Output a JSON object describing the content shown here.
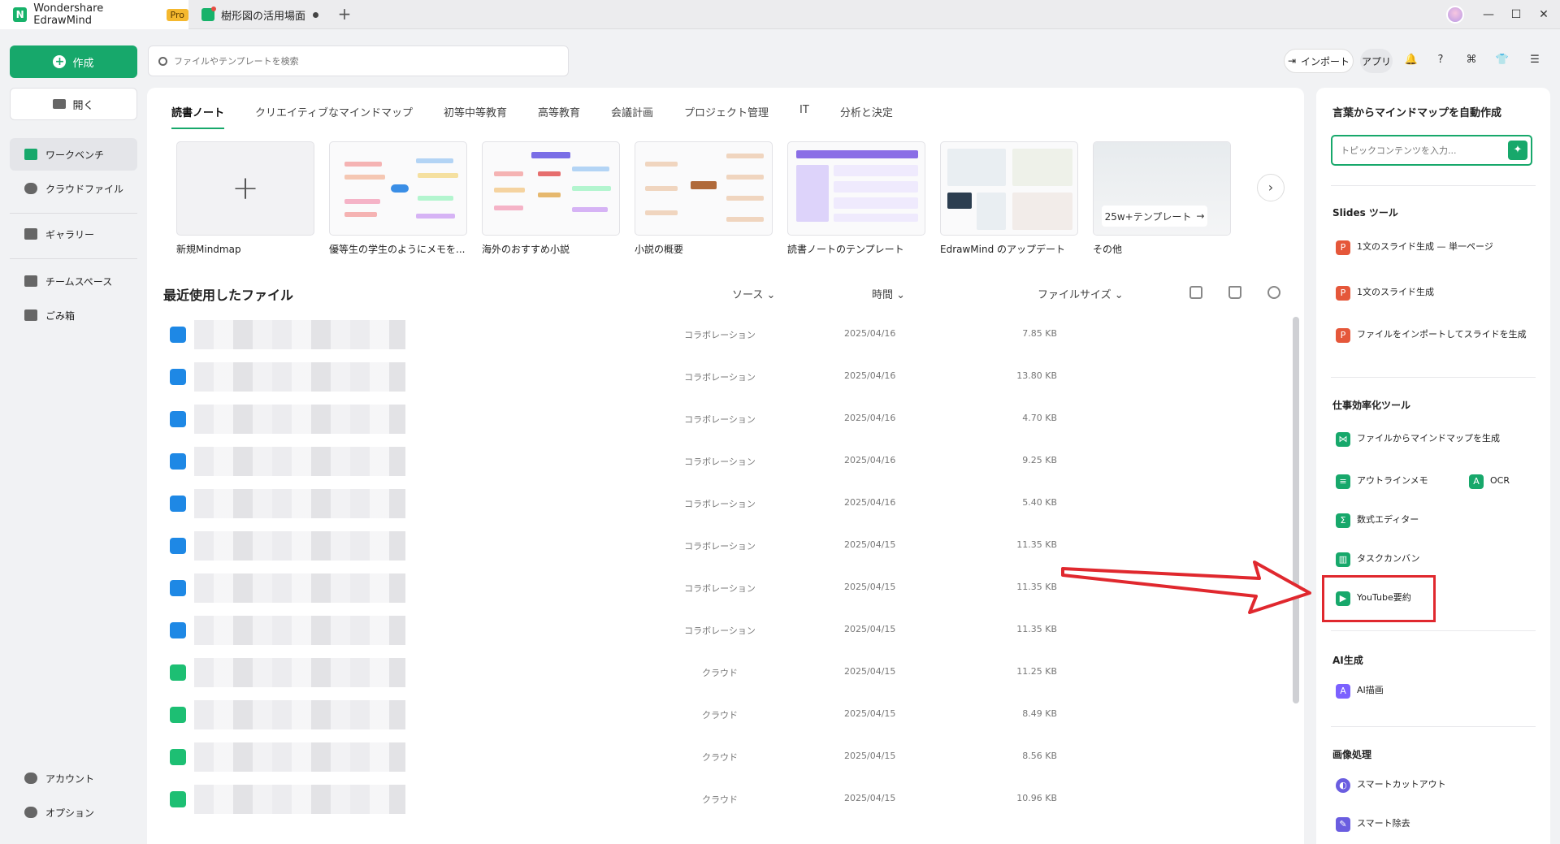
{
  "titlebar": {
    "app_name": "Wondershare EdrawMind",
    "pro_badge": "Pro",
    "doc_tab": "樹形図の活用場面",
    "new_tab": "+",
    "minimize": "—",
    "maximize": "☐",
    "close": "✕"
  },
  "sidebar": {
    "create": "作成",
    "open": "開く",
    "items": [
      {
        "label": "ワークベンチ",
        "icon": "workbench-icon"
      },
      {
        "label": "クラウドファイル",
        "icon": "cloud-icon"
      },
      {
        "label": "ギャラリー",
        "icon": "gallery-icon"
      },
      {
        "label": "チームスペース",
        "icon": "team-icon"
      },
      {
        "label": "ごみ箱",
        "icon": "trash-icon"
      }
    ],
    "account": "アカウント",
    "options": "オプション"
  },
  "search": {
    "placeholder": "ファイルやテンプレートを検索"
  },
  "toolbar": {
    "import": "インポート",
    "apps": "アプリ"
  },
  "categories": [
    "読書ノート",
    "クリエイティブなマインドマップ",
    "初等中等教育",
    "高等教育",
    "会議計画",
    "プロジェクト管理",
    "IT",
    "分析と決定"
  ],
  "templates": [
    {
      "label": "新規Mindmap"
    },
    {
      "label": "優等生の学生のようにメモを..."
    },
    {
      "label": "海外のおすすめ小説"
    },
    {
      "label": "小説の概要"
    },
    {
      "label": "読書ノートのテンプレート"
    },
    {
      "label": "EdrawMind のアップデート"
    },
    {
      "label": "その他",
      "pill": "25w+テンプレート"
    }
  ],
  "recent": {
    "title": "最近使用したファイル",
    "col_source": "ソース",
    "col_time": "時間",
    "col_size": "ファイルサイズ",
    "rows": [
      {
        "type": "collab",
        "source": "コラボレーション",
        "time": "2025/04/16",
        "size": "7.85 KB"
      },
      {
        "type": "collab",
        "source": "コラボレーション",
        "time": "2025/04/16",
        "size": "13.80 KB"
      },
      {
        "type": "collab",
        "source": "コラボレーション",
        "time": "2025/04/16",
        "size": "4.70 KB"
      },
      {
        "type": "collab",
        "source": "コラボレーション",
        "time": "2025/04/16",
        "size": "9.25 KB"
      },
      {
        "type": "collab",
        "source": "コラボレーション",
        "time": "2025/04/16",
        "size": "5.40 KB"
      },
      {
        "type": "collab",
        "source": "コラボレーション",
        "time": "2025/04/15",
        "size": "11.35 KB"
      },
      {
        "type": "collab",
        "source": "コラボレーション",
        "time": "2025/04/15",
        "size": "11.35 KB"
      },
      {
        "type": "collab",
        "source": "コラボレーション",
        "time": "2025/04/15",
        "size": "11.35 KB"
      },
      {
        "type": "cloud",
        "source": "クラウド",
        "time": "2025/04/15",
        "size": "11.25 KB"
      },
      {
        "type": "cloud",
        "source": "クラウド",
        "time": "2025/04/15",
        "size": "8.49 KB"
      },
      {
        "type": "cloud",
        "source": "クラウド",
        "time": "2025/04/15",
        "size": "8.56 KB"
      },
      {
        "type": "cloud",
        "source": "クラウド",
        "time": "2025/04/15",
        "size": "10.96 KB"
      }
    ]
  },
  "right_panel": {
    "auto_title": "言葉からマインドマップを自動作成",
    "auto_placeholder": "トピックコンテンツを入力...",
    "slides_title": "Slides ツール",
    "slides": [
      "1文のスライド生成 — 単一ページ",
      "1文のスライド生成",
      "ファイルをインポートしてスライドを生成"
    ],
    "efficiency_title": "仕事効率化ツール",
    "efficiency": {
      "file_to_map": "ファイルからマインドマップを生成",
      "outline": "アウトラインメモ",
      "ocr": "OCR",
      "formula": "数式エディター",
      "kanban": "タスクカンバン",
      "youtube": "YouTube要約"
    },
    "ai_title": "AI生成",
    "ai_draw": "AI描画",
    "image_title": "画像処理",
    "image": [
      "スマートカットアウト",
      "スマート除去"
    ]
  },
  "colors": {
    "accent": "#17a86b",
    "highlight": "#e0282e",
    "collab": "#1e88e5",
    "cloud": "#1dbf73"
  }
}
